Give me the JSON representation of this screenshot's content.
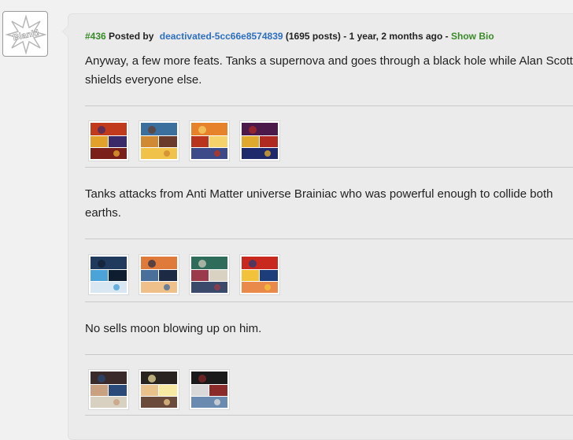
{
  "post": {
    "number": "#436",
    "posted_by": "Posted by",
    "username": "deactivated-5cc66e8574839",
    "post_count": "(1695 posts)",
    "separator1": "-",
    "time_ago": "1 year, 2 months ago",
    "separator2": "-",
    "show_bio": "Show Bio"
  },
  "avatar": {
    "text": "Blank!"
  },
  "paragraphs": [
    "Anyway, a few more feats. Tanks a supernova and goes through a black hole while Alan Scott shields everyone else.",
    "Tanks attacks from Anti Matter universe Brainiac who was powerful enough to collide both earths.",
    "No sells moon blowing up on him."
  ],
  "image_groups": [
    {
      "images": [
        {
          "icon": "comic-page-thumbnail",
          "colors": [
            "#c23a1c",
            "#e2a12a",
            "#3a2a6a",
            "#7a1f1a"
          ]
        },
        {
          "icon": "comic-page-thumbnail",
          "colors": [
            "#3b6f9e",
            "#d08a33",
            "#6a3a2a",
            "#f1c24a"
          ]
        },
        {
          "icon": "comic-page-thumbnail",
          "colors": [
            "#e6832a",
            "#b8341c",
            "#f6d36a",
            "#3d4a8a"
          ]
        },
        {
          "icon": "comic-page-thumbnail",
          "colors": [
            "#4b1a4a",
            "#e0a82d",
            "#b02a22",
            "#1e2a6b"
          ]
        }
      ]
    },
    {
      "images": [
        {
          "icon": "comic-page-thumbnail",
          "colors": [
            "#1f3a5c",
            "#4ba3d8",
            "#0f1d30",
            "#d8e7f2"
          ]
        },
        {
          "icon": "comic-page-thumbnail",
          "colors": [
            "#e07a3a",
            "#4a6f9a",
            "#1d2a44",
            "#f0c08a"
          ]
        },
        {
          "icon": "comic-page-thumbnail",
          "colors": [
            "#2f6d5a",
            "#9a3a4a",
            "#d9d2c2",
            "#3b4a6a"
          ]
        },
        {
          "icon": "comic-page-thumbnail",
          "colors": [
            "#c8281e",
            "#f2c23a",
            "#1d3d7a",
            "#e98a4a"
          ]
        }
      ]
    },
    {
      "images": [
        {
          "icon": "comic-page-thumbnail",
          "colors": [
            "#3a2a2a",
            "#c9a080",
            "#2a4a7a",
            "#d8d0c0"
          ]
        },
        {
          "icon": "comic-page-thumbnail",
          "colors": [
            "#2a2420",
            "#e8c28a",
            "#f7e8a2",
            "#6a4a3a"
          ]
        },
        {
          "icon": "comic-page-thumbnail",
          "colors": [
            "#1a1a1a",
            "#d9d9d9",
            "#8a2a2a",
            "#6a8ab0"
          ]
        }
      ]
    }
  ]
}
